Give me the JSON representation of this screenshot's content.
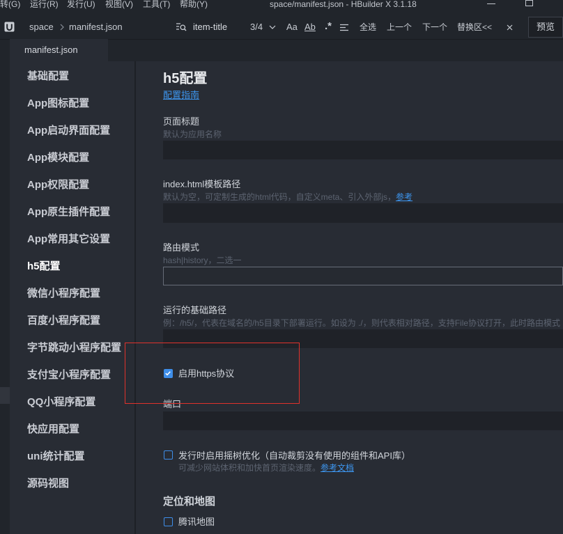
{
  "window": {
    "menu": [
      "转(G)",
      "运行(R)",
      "发行(U)",
      "视图(V)",
      "工具(T)",
      "帮助(Y)"
    ],
    "title": "space/manifest.json - HBuilder X 3.1.18",
    "controls": [
      "minimize-icon",
      "maximize-icon"
    ]
  },
  "toolbar": {
    "logo_icon": "hbuilder-logo-icon",
    "breadcrumb": [
      "space",
      "manifest.json"
    ],
    "breadcrumb_separator_icon": "chevron-right-icon",
    "find": {
      "icon": "find-icon",
      "query": "item-title",
      "match_count": "3/4",
      "history_icon": "chevron-down-icon",
      "match_case": "Aa",
      "whole_word": "Ab",
      "regex": ".*",
      "in_selection_icon": "find-in-selection-icon",
      "select_all": "全选",
      "previous": "上一个",
      "next": "下一个",
      "replace_toggle": "替换区<<",
      "close_icon": "close-icon"
    },
    "preview_button": "预览"
  },
  "tabs": [
    {
      "label": "manifest.json",
      "active": true
    }
  ],
  "sidebar": {
    "items": [
      "基础配置",
      "App图标配置",
      "App启动界面配置",
      "App模块配置",
      "App权限配置",
      "App原生插件配置",
      "App常用其它设置",
      "h5配置",
      "微信小程序配置",
      "百度小程序配置",
      "字节跳动小程序配置",
      "支付宝小程序配置",
      "QQ小程序配置",
      "快应用配置",
      "uni统计配置",
      "源码视图"
    ],
    "selected_index": 7
  },
  "main": {
    "title": "h5配置",
    "guide_link": "配置指南",
    "page_title": {
      "label": "页面标题",
      "hint": "默认为应用名称"
    },
    "template_path": {
      "label": "index.html模板路径",
      "hint": "默认为空，可定制生成的html代码，自定义meta、引入外部js，",
      "hint_link": "参考"
    },
    "router_mode": {
      "label": "路由模式",
      "hint": "hash|history，二选一"
    },
    "base_path": {
      "label": "运行的基础路径",
      "hint": "例：/h5/，代表在域名的/h5目录下部署运行。如设为 ./，则代表相对路径，支持File协议打开，此时路由模式"
    },
    "https": {
      "label": "启用https协议",
      "checked": true
    },
    "port": {
      "label": "端口"
    },
    "tree_shaking": {
      "label": "发行时启用摇树优化（自动裁剪没有使用的组件和API库）",
      "checked": false,
      "hint": "可减少网站体积和加快首页渲染速度。",
      "hint_link": "参考文档"
    },
    "map_section": {
      "title": "定位和地图",
      "options": [
        {
          "label": "腾讯地图",
          "checked": false
        }
      ]
    }
  },
  "colors": {
    "background": "#282c34",
    "accent": "#3e8ee9",
    "link": "#3d96f0",
    "annotation": "#e0322c"
  }
}
